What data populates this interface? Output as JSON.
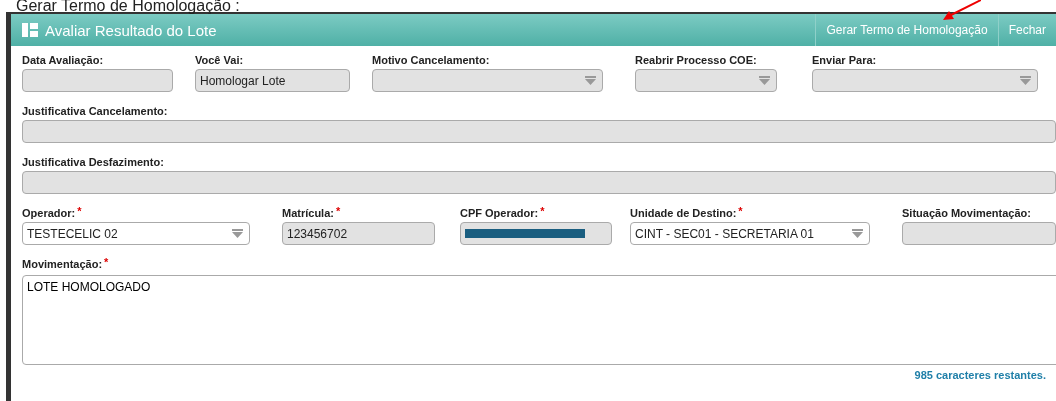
{
  "caption": "Gerar Termo de Homologação :",
  "window": {
    "title": "Avaliar Resultado do Lote",
    "buttons": [
      "Gerar Termo de Homologação",
      "Fechar"
    ]
  },
  "rows": [
    {
      "fields": [
        {
          "label": "Data Avaliação:",
          "kind": "text",
          "disabled": true
        },
        {
          "label": "Você Vai:",
          "kind": "text",
          "disabled": true,
          "value": "Homologar Lote"
        },
        {
          "label": "Motivo Cancelamento:",
          "kind": "select",
          "disabled": true
        },
        {
          "label": "Reabrir Processo COE:",
          "kind": "select",
          "disabled": true
        },
        {
          "label": "Enviar Para:",
          "kind": "select",
          "disabled": true
        }
      ]
    },
    {
      "fields": [
        {
          "label": "Justificativa Cancelamento:",
          "kind": "text",
          "disabled": true
        }
      ]
    },
    {
      "fields": [
        {
          "label": "Justificativa Desfazimento:",
          "kind": "text",
          "disabled": true
        }
      ]
    },
    {
      "fields": [
        {
          "label": "Operador:",
          "required_mark": "*",
          "kind": "select",
          "disabled": false,
          "value": "TESTECELIC 02"
        },
        {
          "label": "Matrícula:",
          "required_mark": "*",
          "kind": "text",
          "disabled": true,
          "value": "123456702"
        },
        {
          "label": "CPF Operador:",
          "required_mark": "*",
          "kind": "redacted",
          "disabled": true
        },
        {
          "label": "Unidade de Destino:",
          "required_mark": "*",
          "kind": "select",
          "disabled": false,
          "value": "CINT - SEC01 - SECRETARIA 01"
        },
        {
          "label": "Situação Movimentação:",
          "kind": "text",
          "disabled": true
        }
      ]
    }
  ],
  "movimentacao": {
    "label": "Movimentação:",
    "required_mark": "*",
    "value": "LOTE HOMOLOGADO",
    "counter": "985 caracteres restantes."
  }
}
